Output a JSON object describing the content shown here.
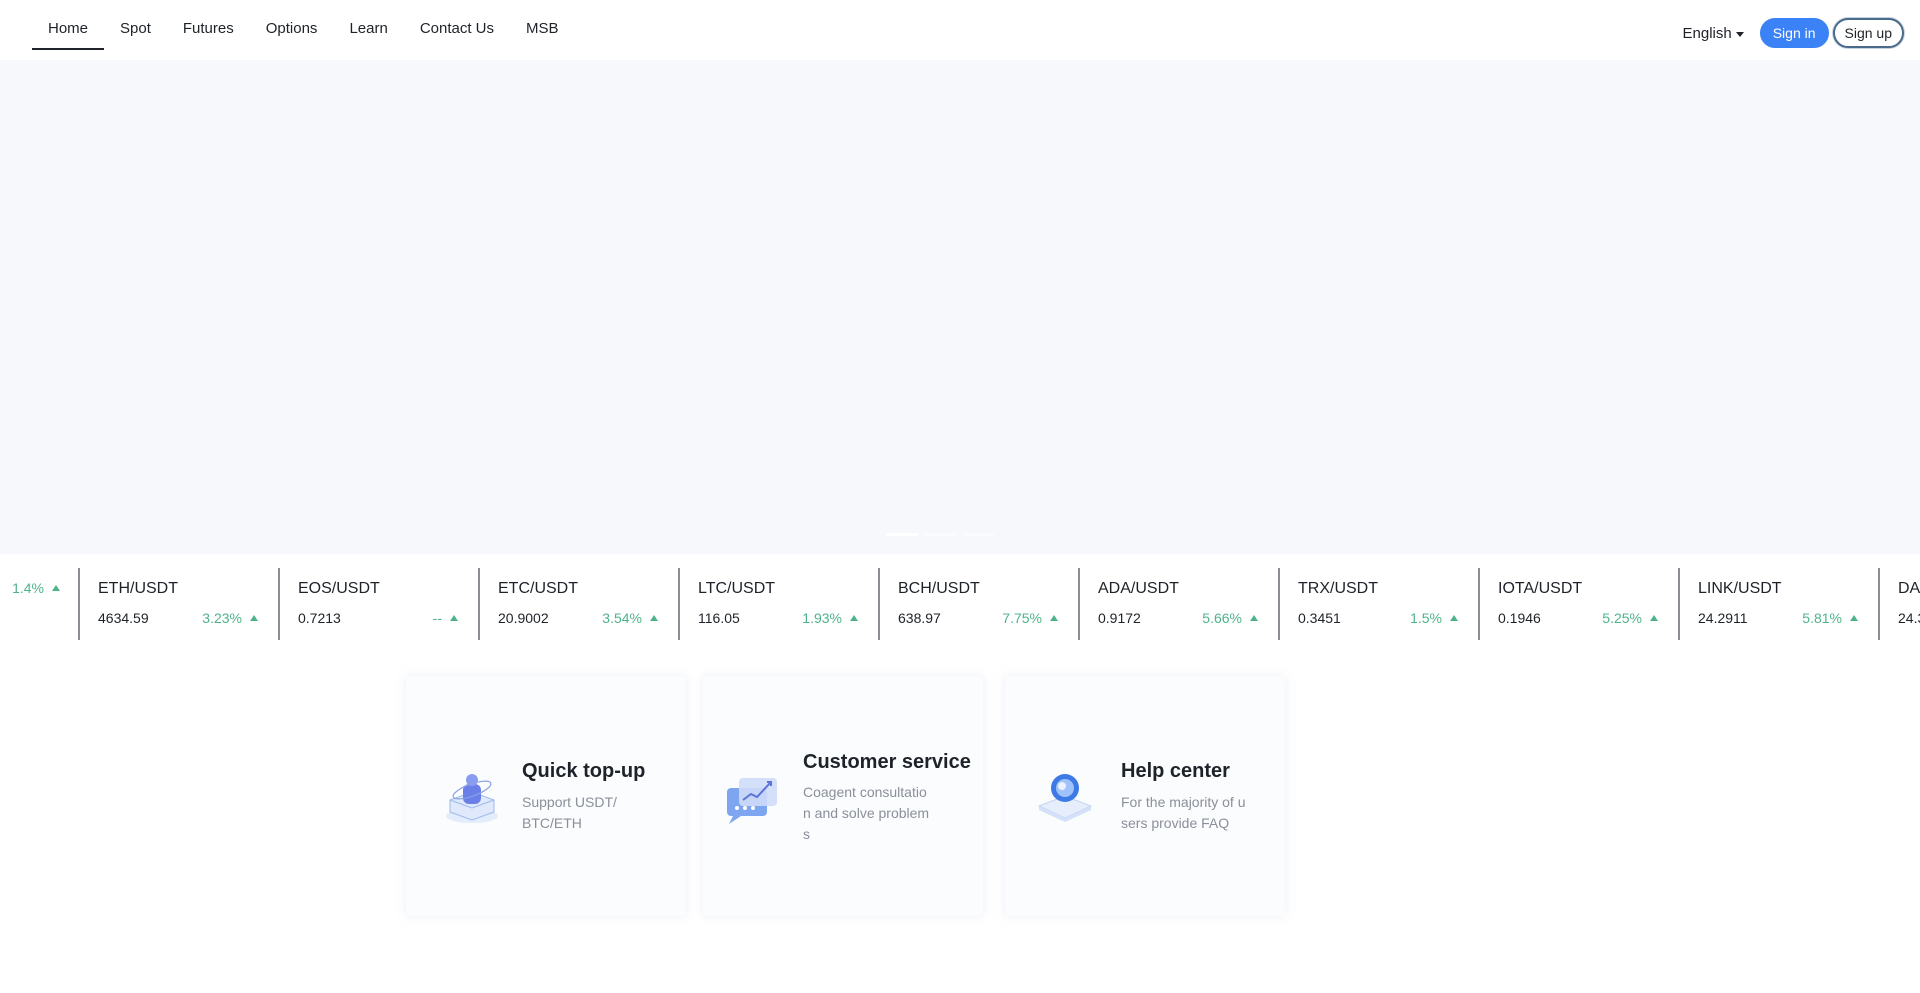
{
  "nav": {
    "items": [
      "Home",
      "Spot",
      "Futures",
      "Options",
      "Learn",
      "Contact Us",
      "MSB"
    ],
    "active": "Home"
  },
  "header": {
    "language": "English",
    "signin_label": "Sign in",
    "signup_label": "Sign up"
  },
  "colors": {
    "accent": "#3b82f6",
    "positive": "#4fb38a",
    "banner_bg": "#f6f8fb"
  },
  "ticker": [
    {
      "pair": "",
      "price": "",
      "change": "1.4%"
    },
    {
      "pair": "ETH/USDT",
      "price": "4634.59",
      "change": "3.23%"
    },
    {
      "pair": "EOS/USDT",
      "price": "0.7213",
      "change": "--"
    },
    {
      "pair": "ETC/USDT",
      "price": "20.9002",
      "change": "3.54%"
    },
    {
      "pair": "LTC/USDT",
      "price": "116.05",
      "change": "1.93%"
    },
    {
      "pair": "BCH/USDT",
      "price": "638.97",
      "change": "7.75%"
    },
    {
      "pair": "ADA/USDT",
      "price": "0.9172",
      "change": "5.66%"
    },
    {
      "pair": "TRX/USDT",
      "price": "0.3451",
      "change": "1.5%"
    },
    {
      "pair": "IOTA/USDT",
      "price": "0.1946",
      "change": "5.25%"
    },
    {
      "pair": "LINK/USDT",
      "price": "24.2911",
      "change": "5.81%"
    },
    {
      "pair": "DA",
      "price": "24.3",
      "change": ""
    }
  ],
  "features": [
    {
      "title": "Quick top-up",
      "desc": "Support USDT/BTC/ETH",
      "icon": "top-up-icon"
    },
    {
      "title": "Customer service",
      "desc": "Coagent consultation and solve problems",
      "icon": "customer-service-icon"
    },
    {
      "title": "Help center",
      "desc": "For the majority of users provide FAQ",
      "icon": "help-center-icon"
    }
  ]
}
